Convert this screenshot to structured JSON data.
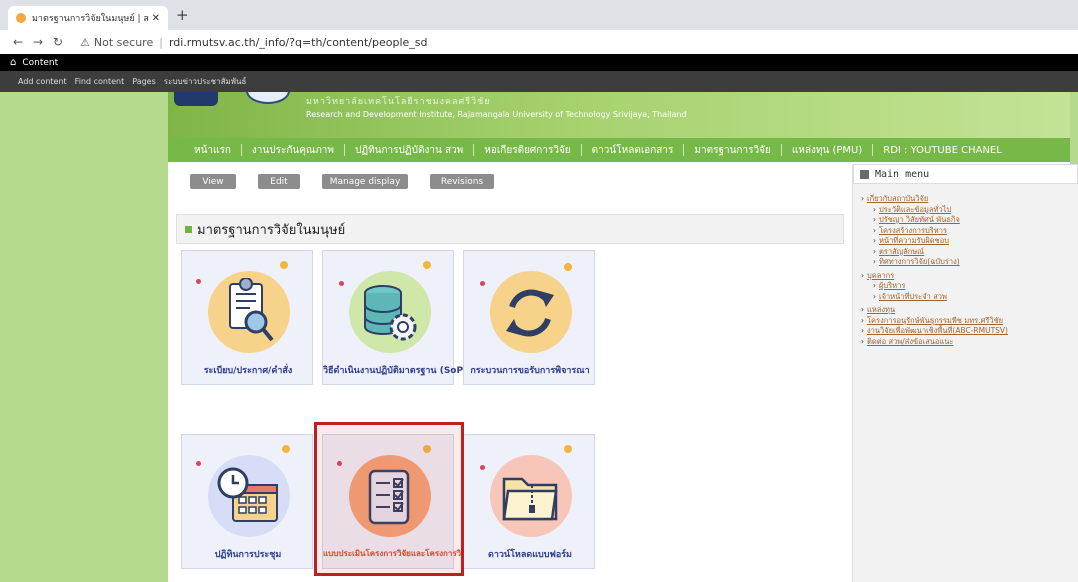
{
  "browser": {
    "tab_title": "มาตรฐานการวิจัยในมนุษย์ | สถาบันวิจั",
    "tab_close": "✕",
    "new_tab": "+",
    "security": "Not secure",
    "url": "rdi.rmutsv.ac.th/_info/?q=th/content/people_sd"
  },
  "admin": {
    "content_label": "Content",
    "shortcuts": [
      "Add content",
      "Find content",
      "Pages",
      "ระบบข่าวประชาสัมพันธ์"
    ]
  },
  "banner": {
    "thai": "มหาวิทยาลัยเทคโนโลยีราชมงคลศรีวิชัย",
    "english": "Research and Development Institute, Rajamangala University of Technology Srivijaya, Thailand"
  },
  "nav": [
    "หน้าแรก",
    "งานประกันคุณภาพ",
    "ปฏิทินการปฏิบัติงาน สวพ",
    "หอเกียรติยศการวิจัย",
    "ดาวน์โหลดเอกสาร",
    "มาตรฐานการวิจัย",
    "แหล่งทุน (PMU)",
    "RDI : YOUTUBE CHANEL"
  ],
  "actions": [
    "View",
    "Edit",
    "Manage display",
    "Revisions"
  ],
  "section_title": "มาตรฐานการวิจัยในมนุษย์",
  "cards": [
    {
      "label": "ระเบียบ/ประกาศ/คำสั่ง",
      "icon": "document-search-icon",
      "color": "#f6d28b"
    },
    {
      "label": "วิธีดำเนินงานปฏิบัติมาตรฐาน (SoP)",
      "icon": "database-gear-icon",
      "color": "#cfe7a8"
    },
    {
      "label": "กระบวนการขอรับการพิจารณา",
      "icon": "refresh-cycle-icon",
      "color": "#f6d28b"
    },
    {
      "label": "ปฏิทินการประชุม",
      "icon": "clock-calendar-icon",
      "color": "#d7ddf6"
    },
    {
      "label": "แบบประเมินโครงการวิจัยและโครงการวิจัย",
      "icon": "checklist-icon",
      "color": "#f3a47a"
    },
    {
      "label": "ดาวน์โหลดแบบฟอร์ม",
      "icon": "folder-zip-icon",
      "color": "#f7c6b9"
    }
  ],
  "sidebar": {
    "title": "Main menu",
    "items": [
      {
        "text": "เกี่ยวกับสถาบันวิจัย",
        "level": 0
      },
      {
        "text": "ประวัติและข้อมูลทั่วไป",
        "level": 1
      },
      {
        "text": "ปรัชญา วิสัยทัศน์ พันธกิจ",
        "level": 1
      },
      {
        "text": "โครงสร้างการบริหาร",
        "level": 1
      },
      {
        "text": "หน้าที่ความรับผิดชอบ",
        "level": 1
      },
      {
        "text": "ตราสัญลักษณ์",
        "level": 1
      },
      {
        "text": "ทิศทางการวิจัย(ฉบับร่าง)",
        "level": 1
      },
      {
        "text": "บุคลากร",
        "level": 0
      },
      {
        "text": "ผู้บริหาร",
        "level": 1
      },
      {
        "text": "เจ้าหน้าที่ประจำ สวพ",
        "level": 1
      },
      {
        "text": "แหล่งทุน",
        "level": 0
      },
      {
        "text": "โครงการอนุรักษ์พันธุกรรมพืช มทร.ศรีวิชัย",
        "level": 0
      },
      {
        "text": "งานวิจัยเพื่อพัฒนาเชิงพื้นที่(ABC-RMUTSV)",
        "level": 0
      },
      {
        "text": "ติดต่อ สวพ/ส่งข้อเสนอแนะ",
        "level": 0
      }
    ]
  },
  "colors": {
    "green": "#77b948",
    "highlight": "#c11f1f"
  }
}
